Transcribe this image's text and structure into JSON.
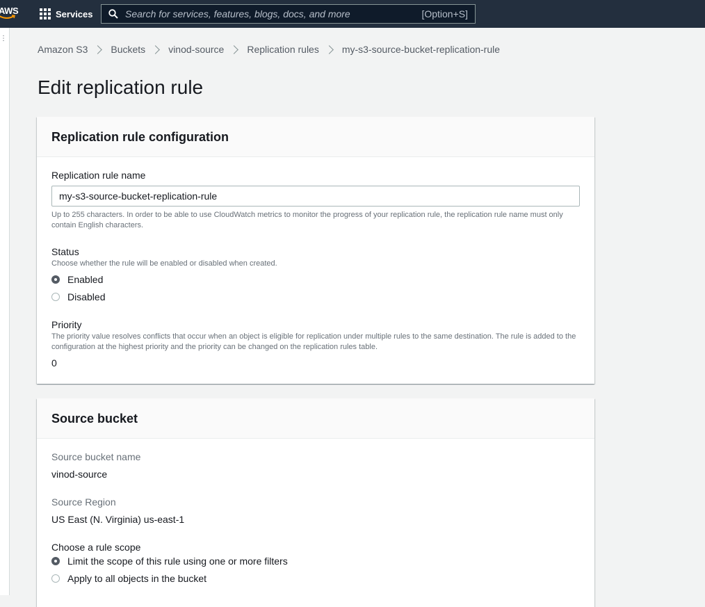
{
  "topnav": {
    "logo_text": "AWS",
    "services_label": "Services",
    "search_placeholder": "Search for services, features, blogs, docs, and more",
    "search_shortcut": "[Option+S]"
  },
  "breadcrumb": {
    "items": [
      "Amazon S3",
      "Buckets",
      "vinod-source",
      "Replication rules",
      "my-s3-source-bucket-replication-rule"
    ]
  },
  "page_title": "Edit replication rule",
  "config_panel": {
    "title": "Replication rule configuration",
    "rule_name_label": "Replication rule name",
    "rule_name_value": "my-s3-source-bucket-replication-rule",
    "rule_name_hint": "Up to 255 characters. In order to be able to use CloudWatch metrics to monitor the progress of your replication rule, the replication rule name must only contain English characters.",
    "status_label": "Status",
    "status_desc": "Choose whether the rule will be enabled or disabled when created.",
    "status_options": [
      "Enabled",
      "Disabled"
    ],
    "status_selected": "Enabled",
    "priority_label": "Priority",
    "priority_desc": "The priority value resolves conflicts that occur when an object is eligible for replication under multiple rules to the same destination. The rule is added to the configuration at the highest priority and the priority can be changed on the replication rules table.",
    "priority_value": "0"
  },
  "source_panel": {
    "title": "Source bucket",
    "bucket_name_label": "Source bucket name",
    "bucket_name_value": "vinod-source",
    "region_label": "Source Region",
    "region_value": "US East (N. Virginia) us-east-1",
    "scope_label": "Choose a rule scope",
    "scope_options": [
      "Limit the scope of this rule using one or more filters",
      "Apply to all objects in the bucket"
    ],
    "scope_selected": "Limit the scope of this rule using one or more filters"
  },
  "colors": {
    "nav_bg": "#232f3e",
    "page_bg": "#f2f3f3",
    "radio_checked": "#545b64"
  }
}
